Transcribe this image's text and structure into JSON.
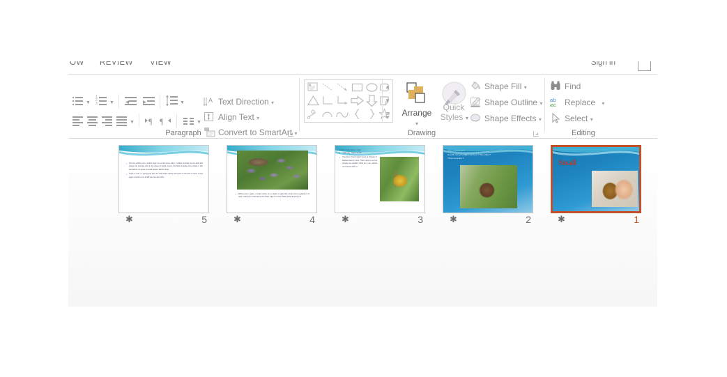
{
  "window": {
    "signin_label": "Sign in",
    "restore_icon": "restore-window-icon"
  },
  "ribbon": {
    "tabs": [
      {
        "label": "OW"
      },
      {
        "label": "REVIEW"
      },
      {
        "label": "VIEW"
      }
    ],
    "collapse_icon": "chevron-up-icon",
    "groups": [
      {
        "name": "paragraph",
        "label": "Paragraph",
        "commands": [
          {
            "name": "bullets",
            "icon": "bullet-list-icon",
            "has_dropdown": true
          },
          {
            "name": "numbering",
            "icon": "numbered-list-icon",
            "has_dropdown": true
          },
          {
            "name": "decrease-indent",
            "icon": "decrease-indent-icon",
            "has_dropdown": false
          },
          {
            "name": "increase-indent",
            "icon": "increase-indent-icon",
            "has_dropdown": false
          },
          {
            "name": "line-spacing",
            "icon": "line-spacing-icon",
            "has_dropdown": true
          },
          {
            "name": "align-left",
            "icon": "align-left-icon",
            "has_dropdown": false
          },
          {
            "name": "align-center",
            "icon": "align-center-icon",
            "has_dropdown": false
          },
          {
            "name": "align-right",
            "icon": "align-right-icon",
            "has_dropdown": false
          },
          {
            "name": "justify",
            "icon": "justify-icon",
            "has_dropdown": true
          },
          {
            "name": "ltr-text-direction",
            "icon": "left-to-right-icon",
            "has_dropdown": false
          },
          {
            "name": "rtl-text-direction",
            "icon": "right-to-left-icon",
            "has_dropdown": false
          },
          {
            "name": "columns",
            "icon": "columns-icon",
            "has_dropdown": true
          }
        ],
        "labeled_commands": [
          {
            "name": "text-direction",
            "label": "Text Direction",
            "icon": "text-direction-icon",
            "caret": "▾"
          },
          {
            "name": "align-text",
            "label": "Align Text",
            "icon": "align-text-icon",
            "caret": "▾"
          },
          {
            "name": "convert-to-smartart",
            "label": "Convert to SmartArt",
            "icon": "smartart-icon",
            "caret": "▾"
          }
        ]
      },
      {
        "name": "drawing",
        "label": "Drawing",
        "shapes": [
          "text-box-shape",
          "line-shape",
          "arrow-shape",
          "rectangle-shape",
          "oval-shape",
          "rounded-rectangle-shape",
          "triangle-shape",
          "elbow-connector-shape",
          "elbow-arrow-connector-shape",
          "right-arrow-shape",
          "down-arrow-shape",
          "folded-corner-shape",
          "scribble-shape",
          "arc-shape",
          "double-arc-shape",
          "left-brace-shape",
          "right-brace-shape",
          "star-shape"
        ],
        "gallery_scroll": {
          "up": "▲",
          "down": "▼",
          "more": "☰"
        },
        "buttons": [
          {
            "name": "arrange",
            "label": "Arrange",
            "icon": "arrange-icon",
            "caret": "▾",
            "dimmed": false
          },
          {
            "name": "quick-styles",
            "label": "Quick\nStyles",
            "label_line1": "Quick",
            "label_line2": "Styles",
            "icon": "quick-styles-icon",
            "caret": "▾",
            "dimmed": true
          }
        ],
        "labeled_commands": [
          {
            "name": "shape-fill",
            "label": "Shape Fill",
            "icon": "paint-bucket-icon",
            "caret": "▾"
          },
          {
            "name": "shape-outline",
            "label": "Shape Outline",
            "icon": "pencil-outline-icon",
            "caret": "▾"
          },
          {
            "name": "shape-effects",
            "label": "Shape Effects",
            "icon": "shape-effects-icon",
            "caret": "▾"
          }
        ]
      },
      {
        "name": "editing",
        "label": "Editing",
        "labeled_commands": [
          {
            "name": "find",
            "label": "Find",
            "icon": "binoculars-icon",
            "caret": ""
          },
          {
            "name": "replace",
            "label": "Replace",
            "icon": "replace-ab-ac-icon",
            "caret": "▾"
          },
          {
            "name": "select",
            "label": "Select",
            "icon": "cursor-arrow-icon",
            "caret": "▾"
          }
        ]
      }
    ]
  },
  "slide_panel": {
    "selected_index": 0,
    "slides": [
      {
        "number": "1",
        "name": "slide-thumbnail-1",
        "selected": true,
        "animation_star": "✱",
        "background": "blue-gradient",
        "title": "Snail",
        "photo": "coin-and-snail-photo"
      },
      {
        "number": "2",
        "name": "slide-thumbnail-2",
        "selected": false,
        "animation_star": "✱",
        "background": "blue-gradient",
        "heading": "I don' t think a pen.",
        "lines": [
          "How far can you walk in an hour ? Two miles ?",
          "Three more lies ?"
        ],
        "photo": "snail-on-leaf-photo"
      },
      {
        "number": "3",
        "name": "slide-thumbnail-3",
        "selected": false,
        "animation_star": "✱",
        "background": "white-wave",
        "heading": "That’s how fast a snail",
        "bullets": [
          "might say. That's not fair.",
          "One kind of land snail moves at thirteen or fourteen feet an hour. That's slow to us, but maybe we wouldn't think so if we carried our houses with us."
        ],
        "photo": "yellow-snail-on-stem-photo"
      },
      {
        "number": "4",
        "name": "slide-thumbnail-4",
        "selected": false,
        "animation_star": "✱",
        "background": "white-wave",
        "bullets": [
          "Where-ever it goes, a snail moves on a carpet of glue that comes from a gland in its body; snails can crawl along the sharp edge of a razor blade without being cut!"
        ],
        "photo": "snail-on-purple-flowers-photo"
      },
      {
        "number": "5",
        "name": "slide-thumbnail-5",
        "selected": false,
        "animation_star": "✱",
        "background": "white-wave",
        "bullets": [
          "The sun will dry out a snail's body, so on hot sunny days, it draws its body into its shell and closes the opening with a thin sheet of glued mucus, the food hungrily every where it can eat well for its sense of smell helps it find the food.",
          "Twice a year, in spring and fall, the snail stops eating and goes to look for a mate; it lays eggs a month or so small you can see them."
        ]
      }
    ]
  },
  "colors": {
    "selection_border": "#C1512D",
    "ribbon_text": "#8D8D8D",
    "group_label": "#7B7B7B",
    "slide_blue": "#1779B5",
    "title_red": "#B0443A"
  }
}
